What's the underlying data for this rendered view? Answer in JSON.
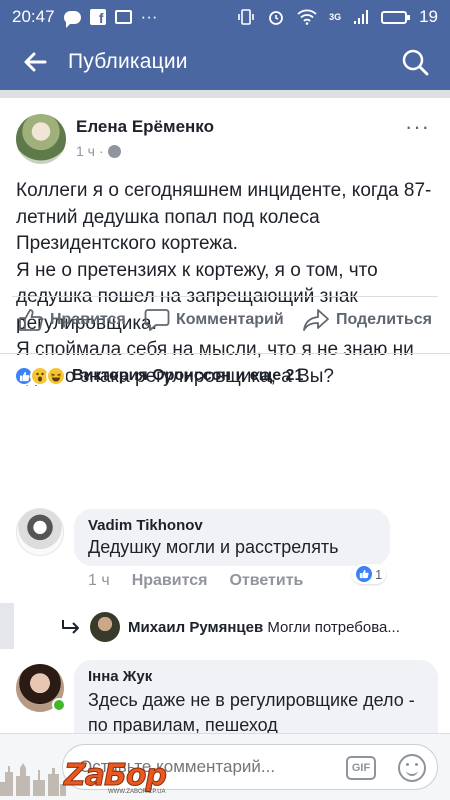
{
  "statusbar": {
    "time": "20:47",
    "more": "···",
    "network": "3G",
    "battery": "19"
  },
  "appbar": {
    "title": "Публикации"
  },
  "post": {
    "author": "Елена Ерёменко",
    "time": "1 ч",
    "more": "···",
    "text": [
      "Коллеги я о сегодняшнем инциденте, когда 87-летний дедушка попал под колеса Президентского кортежа.",
      "Я не о претензиях к кортежу, я о том, что дедушка пошел на запрещающий знак регулировщика.",
      "Я спой­мала себя на мысли, что я не знаю ни одного знака регулировщика, а Вы?"
    ],
    "actions": {
      "like": "Нравится",
      "comment": "Комментарий",
      "share": "Поделиться"
    },
    "reactions_text": "Виктория Оронссон и еще 21"
  },
  "comments": [
    {
      "name": "Vadim Tikhonov",
      "text": "Дедушку могли и расстрелять",
      "time": "1 ч",
      "like": "Нравится",
      "reply": "Ответить",
      "likes": "1",
      "reply_preview": {
        "name": "Михаил Румянцев",
        "text": "Могли потребова..."
      }
    },
    {
      "name": "Інна Жук",
      "text": "Здесь даже не в регулировщике дело - по правилам, пешеход"
    }
  ],
  "composer": {
    "placeholder": "Оставьте комментарий...",
    "gif": "GIF"
  },
  "watermark": {
    "logo": "ZaБор",
    "url": "WWW.ZABOR.ZP.UA"
  },
  "colors": {
    "brand": "#4b67a1",
    "like": "#3b82f6",
    "online": "#42b72a",
    "watermark": "#e8581f"
  }
}
